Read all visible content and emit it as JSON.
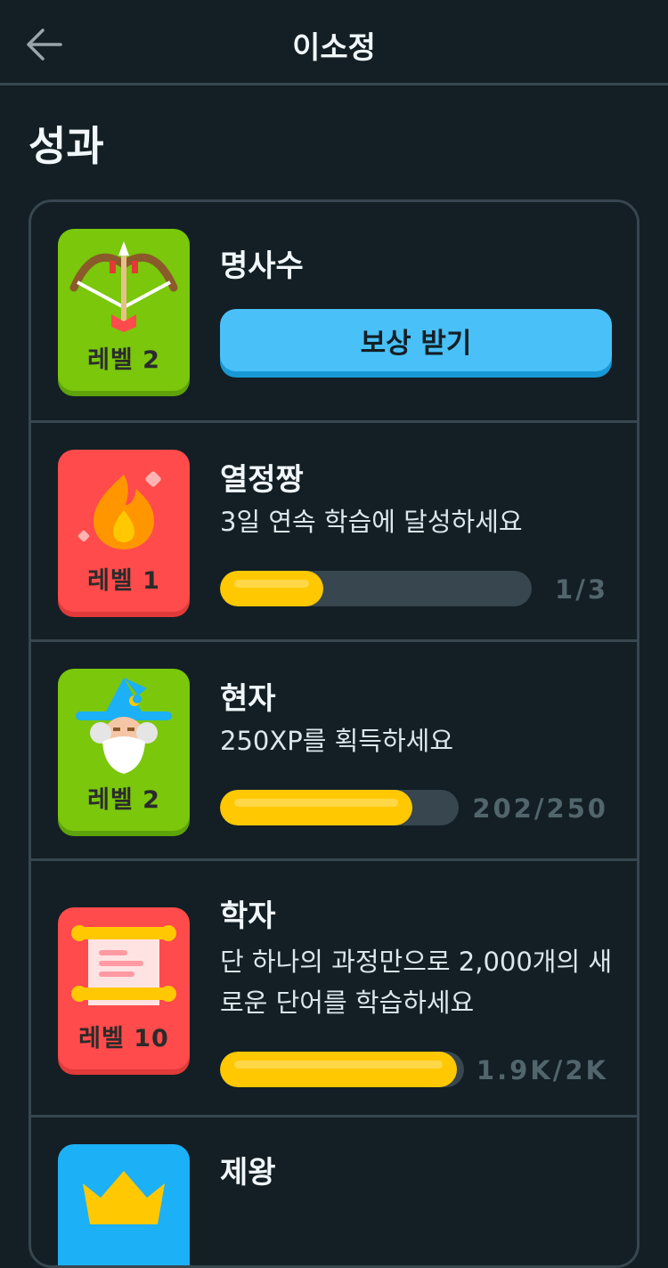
{
  "header": {
    "title": "이소정",
    "back_icon": "arrow-left-icon"
  },
  "section": {
    "title": "성과"
  },
  "achievements": [
    {
      "name": "명사수",
      "level": "레벨 2",
      "icon": "bow-arrow-icon",
      "badge_color": "#7ac70c",
      "action_label": "보상 받기"
    },
    {
      "name": "열정짱",
      "level": "레벨 1",
      "icon": "fire-icon",
      "badge_color": "#ff4b4b",
      "description": "3일 연속 학습에 달성하세요",
      "progress_text": "1/3",
      "progress": 0.333
    },
    {
      "name": "현자",
      "level": "레벨 2",
      "icon": "wizard-icon",
      "badge_color": "#7ac70c",
      "description": "250XP를 획득하세요",
      "progress_text": "202/250",
      "progress": 0.808
    },
    {
      "name": "학자",
      "level": "레벨 10",
      "icon": "scroll-icon",
      "badge_color": "#ff4b4b",
      "description": "단 하나의 과정만으로 2,000개의 새로운 단어를 학습하세요",
      "progress_text": "1.9K/2K",
      "progress": 0.95
    },
    {
      "name": "제왕",
      "icon": "crown-icon",
      "badge_color": "#1cb0f6"
    }
  ]
}
